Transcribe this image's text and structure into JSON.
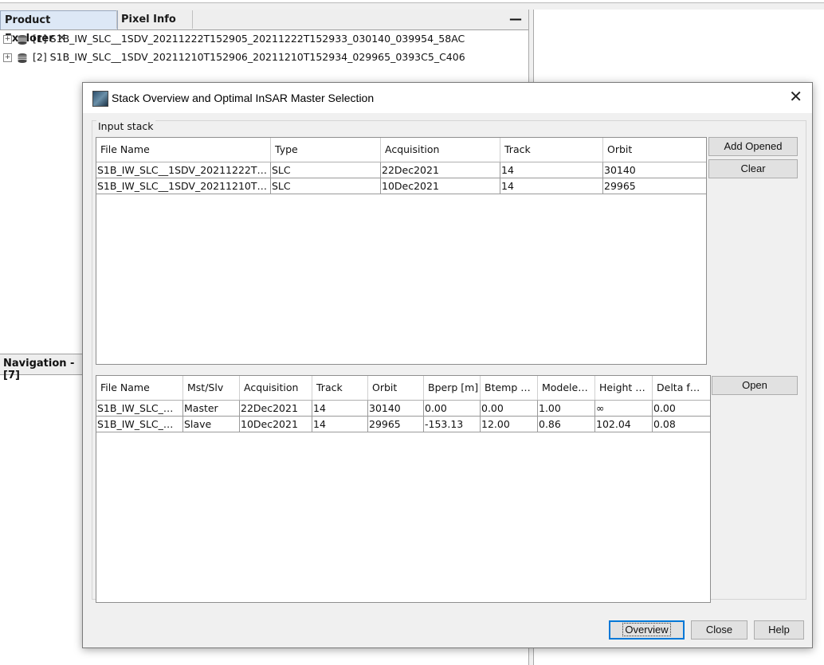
{
  "product_explorer": {
    "tabs": [
      {
        "label": "Product Explorer",
        "close": "✕"
      },
      {
        "label": "Pixel Info"
      }
    ],
    "minimize": "—",
    "products": [
      {
        "label": "[1] S1B_IW_SLC__1SDV_20211222T152905_20211222T152933_030140_039954_58AC"
      },
      {
        "label": "[2] S1B_IW_SLC__1SDV_20211210T152906_20211210T152934_029965_0393C5_C406"
      }
    ]
  },
  "navigation": {
    "label": "Navigation - [7]"
  },
  "dialog": {
    "title": "Stack Overview and Optimal InSAR Master Selection",
    "close": "✕",
    "input_stack": {
      "legend": "Input stack",
      "columns": [
        "File Name",
        "Type",
        "Acquisition",
        "Track",
        "Orbit"
      ],
      "rows": [
        [
          "S1B_IW_SLC__1SDV_20211222T…",
          "SLC",
          "22Dec2021",
          "14",
          "30140"
        ],
        [
          "S1B_IW_SLC__1SDV_20211210T…",
          "SLC",
          "10Dec2021",
          "14",
          "29965"
        ]
      ],
      "buttons": {
        "add_opened": "Add Opened",
        "clear": "Clear"
      }
    },
    "overview": {
      "columns": [
        "File Name",
        "Mst/Slv",
        "Acquisition",
        "Track",
        "Orbit",
        "Bperp [m]",
        "Btemp …",
        "Modele…",
        "Height …",
        "Delta f…"
      ],
      "rows": [
        [
          "S1B_IW_SLC_…",
          "Master",
          "22Dec2021",
          "14",
          "30140",
          "0.00",
          "0.00",
          "1.00",
          "∞",
          "0.00"
        ],
        [
          "S1B_IW_SLC_…",
          "Slave",
          "10Dec2021",
          "14",
          "29965",
          "-153.13",
          "12.00",
          "0.86",
          "102.04",
          "0.08"
        ]
      ],
      "buttons": {
        "open": "Open"
      }
    },
    "footer": {
      "overview": "Overview",
      "close": "Close",
      "help": "Help"
    }
  }
}
